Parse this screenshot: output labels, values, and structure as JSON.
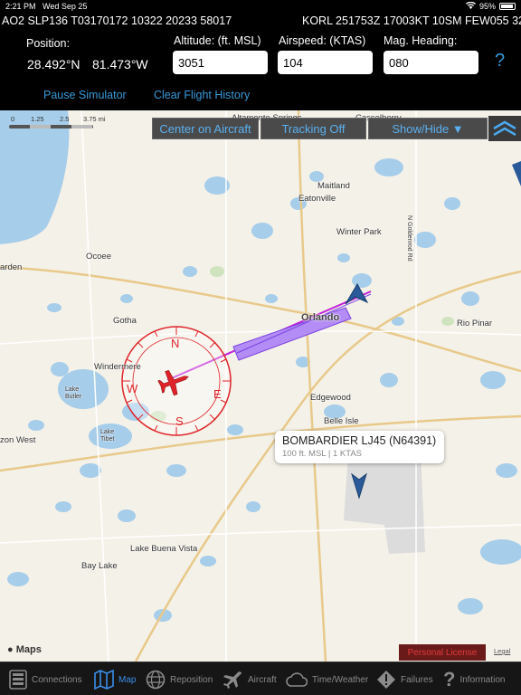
{
  "status_bar": {
    "time": "2:21 PM",
    "date": "Wed Sep 25",
    "battery": "95%"
  },
  "metar": {
    "left": "AO2 SLP136 T03170172 10322 20233 58017",
    "right": "KORL 251753Z 17003KT 10SM FEW055 32"
  },
  "position": {
    "label": "Position:",
    "lat": "28.492°N",
    "lon": "81.473°W"
  },
  "altitude": {
    "label": "Altitude: (ft. MSL)",
    "value": "3051"
  },
  "airspeed": {
    "label": "Airspeed: (KTAS)",
    "value": "104"
  },
  "heading": {
    "label": "Mag. Heading:",
    "value": "080"
  },
  "help_label": "?",
  "actions": {
    "pause": "Pause Simulator",
    "clear": "Clear Flight History"
  },
  "map_controls": {
    "center": "Center on Aircraft",
    "tracking": "Tracking Off",
    "showhide": "Show/Hide ▼"
  },
  "scale": {
    "t0": "0",
    "t1": "1.25",
    "t2": "2.5",
    "t3": "3.75 mi"
  },
  "places": {
    "altamonte": "Altamonte Springs",
    "casselberry": "Casselberry",
    "maitland": "Maitland",
    "eatonville": "Eatonville",
    "winterpark": "Winter Park",
    "ocoee": "Ocoee",
    "arden": "arden",
    "gotha": "Gotha",
    "orlando": "Orlando",
    "riopinar": "Rio Pinar",
    "windermere": "Windermere",
    "lakebutler": "Lake Butler",
    "edgewood": "Edgewood",
    "belleisle": "Belle Isle",
    "zonwest": "zon West",
    "laketibet": "Lake Tibet",
    "lakebuenavista": "Lake Buena Vista",
    "baylake": "Bay Lake",
    "goldenrod": "N Goldenrod Rd"
  },
  "compass": {
    "n": "N",
    "s": "S",
    "e": "E",
    "w": "W"
  },
  "traffic": {
    "title": "BOMBARDIER LJ45 (N64391)",
    "detail": "100 ft. MSL | 1 KTAS"
  },
  "map_footer": {
    "brand": "Maps",
    "personal": "Personal License",
    "legal": "Legal"
  },
  "tabs": [
    {
      "label": "Connections"
    },
    {
      "label": "Map"
    },
    {
      "label": "Reposition"
    },
    {
      "label": "Aircraft"
    },
    {
      "label": "Time/Weather"
    },
    {
      "label": "Failures"
    },
    {
      "label": "Information"
    }
  ],
  "colors": {
    "accent": "#3a8ee8",
    "aircraft": "#e0242a",
    "track": "#9b5cf0",
    "traffic": "#2a5a9a"
  }
}
